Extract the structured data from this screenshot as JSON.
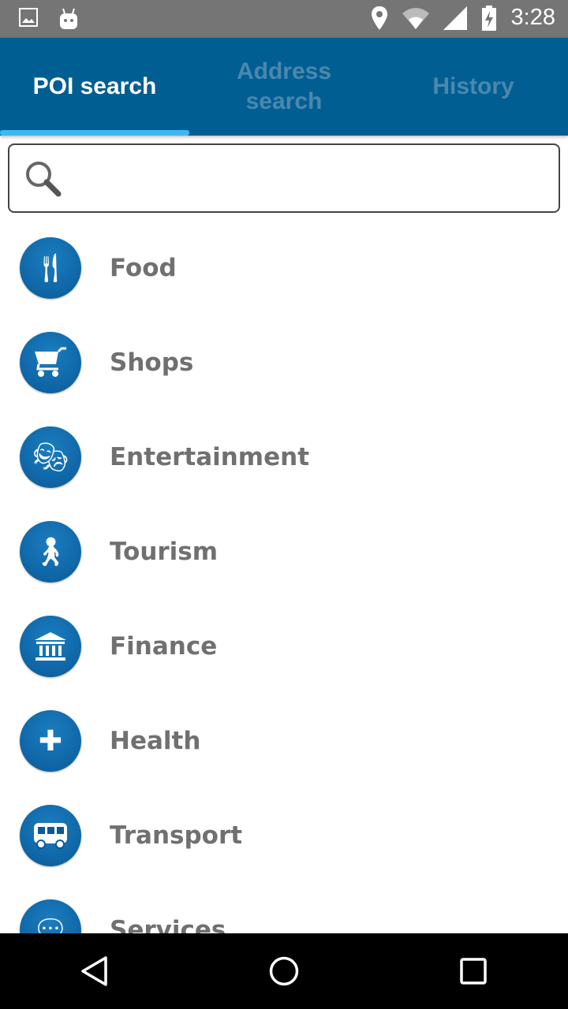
{
  "status_bar": {
    "time": "3:28",
    "icons": [
      "image-icon",
      "android-icon",
      "location-icon",
      "wifi-icon",
      "signal-icon",
      "battery-charging-icon"
    ]
  },
  "tabs": [
    {
      "label": "POI search",
      "active": true
    },
    {
      "label": "Address search",
      "active": false
    },
    {
      "label": "History",
      "active": false
    }
  ],
  "search": {
    "value": "",
    "placeholder": ""
  },
  "categories": [
    {
      "label": "Food",
      "icon": "cutlery-icon"
    },
    {
      "label": "Shops",
      "icon": "cart-icon"
    },
    {
      "label": "Entertainment",
      "icon": "theater-masks-icon"
    },
    {
      "label": "Tourism",
      "icon": "traveler-icon"
    },
    {
      "label": "Finance",
      "icon": "bank-icon"
    },
    {
      "label": "Health",
      "icon": "stethoscope-icon"
    },
    {
      "label": "Transport",
      "icon": "bus-icon"
    },
    {
      "label": "Services",
      "icon": "chat-icon"
    }
  ],
  "colors": {
    "header": "#015e93",
    "indicator": "#3db8f5",
    "icon_bg": "#0a5a98",
    "label": "#707070"
  }
}
